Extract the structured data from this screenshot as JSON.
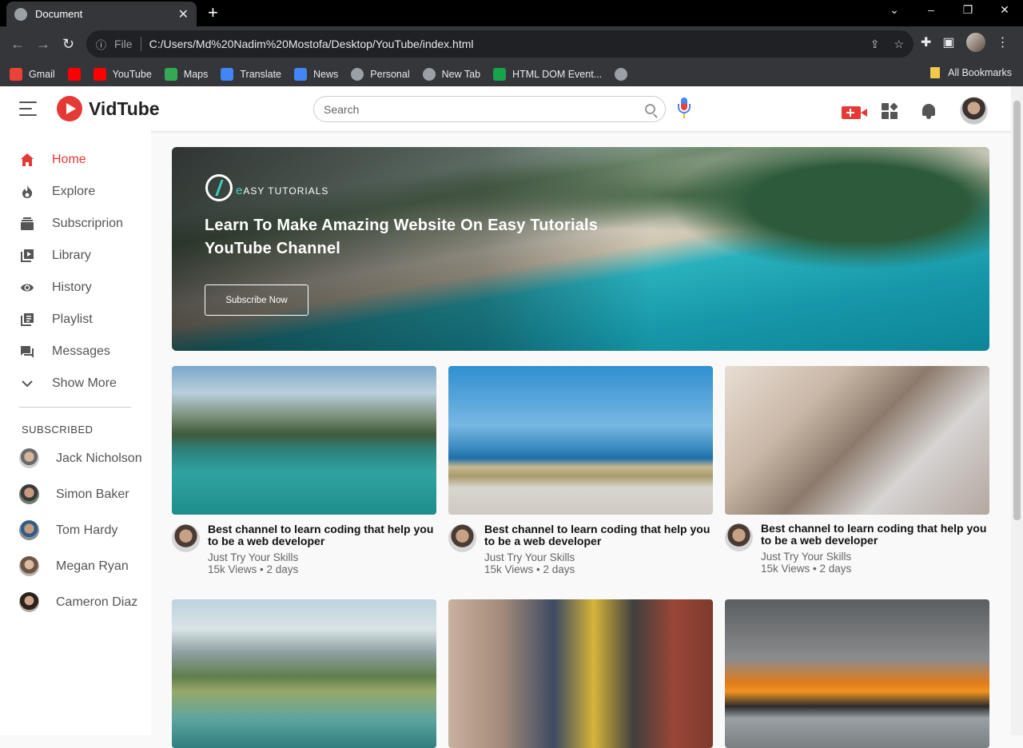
{
  "browser": {
    "tab_title": "Document",
    "new_tab_symbol": "+",
    "url_prefix": "File",
    "url": "C:/Users/Md%20Nadim%20Mostofa/Desktop/YouTube/index.html",
    "bookmarks": [
      "Gmail",
      "YouTube",
      "Maps",
      "Translate",
      "News",
      "Personal",
      "New Tab",
      "HTML DOM Event..."
    ],
    "bookmarks_all": "All Bookmarks",
    "bookmark_colors": [
      "#ea4335",
      "#ff0000",
      "#ff0000",
      "#34a853",
      "#4285f4",
      "#4285f4",
      "#5f6368",
      "#5f6368",
      "#17a34a"
    ]
  },
  "app": {
    "logo_text": "VidTube",
    "search_placeholder": "Search",
    "accent_color": "#e53935"
  },
  "sidebar": {
    "items": [
      {
        "label": "Home",
        "icon": "home-icon",
        "active": true
      },
      {
        "label": "Explore",
        "icon": "explore-icon"
      },
      {
        "label": "Subscriprion",
        "icon": "subscription-icon"
      },
      {
        "label": "Library",
        "icon": "library-icon"
      },
      {
        "label": "History",
        "icon": "history-icon"
      },
      {
        "label": "Playlist",
        "icon": "playlist-icon"
      },
      {
        "label": "Messages",
        "icon": "messages-icon"
      },
      {
        "label": "Show More",
        "icon": "chevron-down-icon"
      }
    ],
    "subscribed_title": "SUBSCRIBED",
    "subscriptions": [
      "Jack Nicholson",
      "Simon Baker",
      "Tom Hardy",
      "Megan Ryan",
      "Cameron Diaz"
    ]
  },
  "banner": {
    "brand_letter": "e",
    "brand_text": "ASY TUTORIALS",
    "title": "Learn To Make Amazing Website On Easy Tutorials YouTube Channel",
    "button": "Subscribe Now"
  },
  "videos": [
    {
      "title": "Best channel to learn coding that help you to be a web developer",
      "channel": "Just Try Your Skills",
      "stats": "15k Views • 2 days"
    },
    {
      "title": "Best channel to learn coding that help you to be a web developer",
      "channel": "Just Try Your Skills",
      "stats": "15k Views • 2 days"
    },
    {
      "title": "Best channel to learn coding that help you to be a web developer",
      "channel": "Just Try Your Skills",
      "stats": "15k Views • 2 days"
    },
    {
      "title": "",
      "channel": "",
      "stats": ""
    },
    {
      "title": "",
      "channel": "",
      "stats": ""
    },
    {
      "title": "",
      "channel": "",
      "stats": ""
    }
  ]
}
